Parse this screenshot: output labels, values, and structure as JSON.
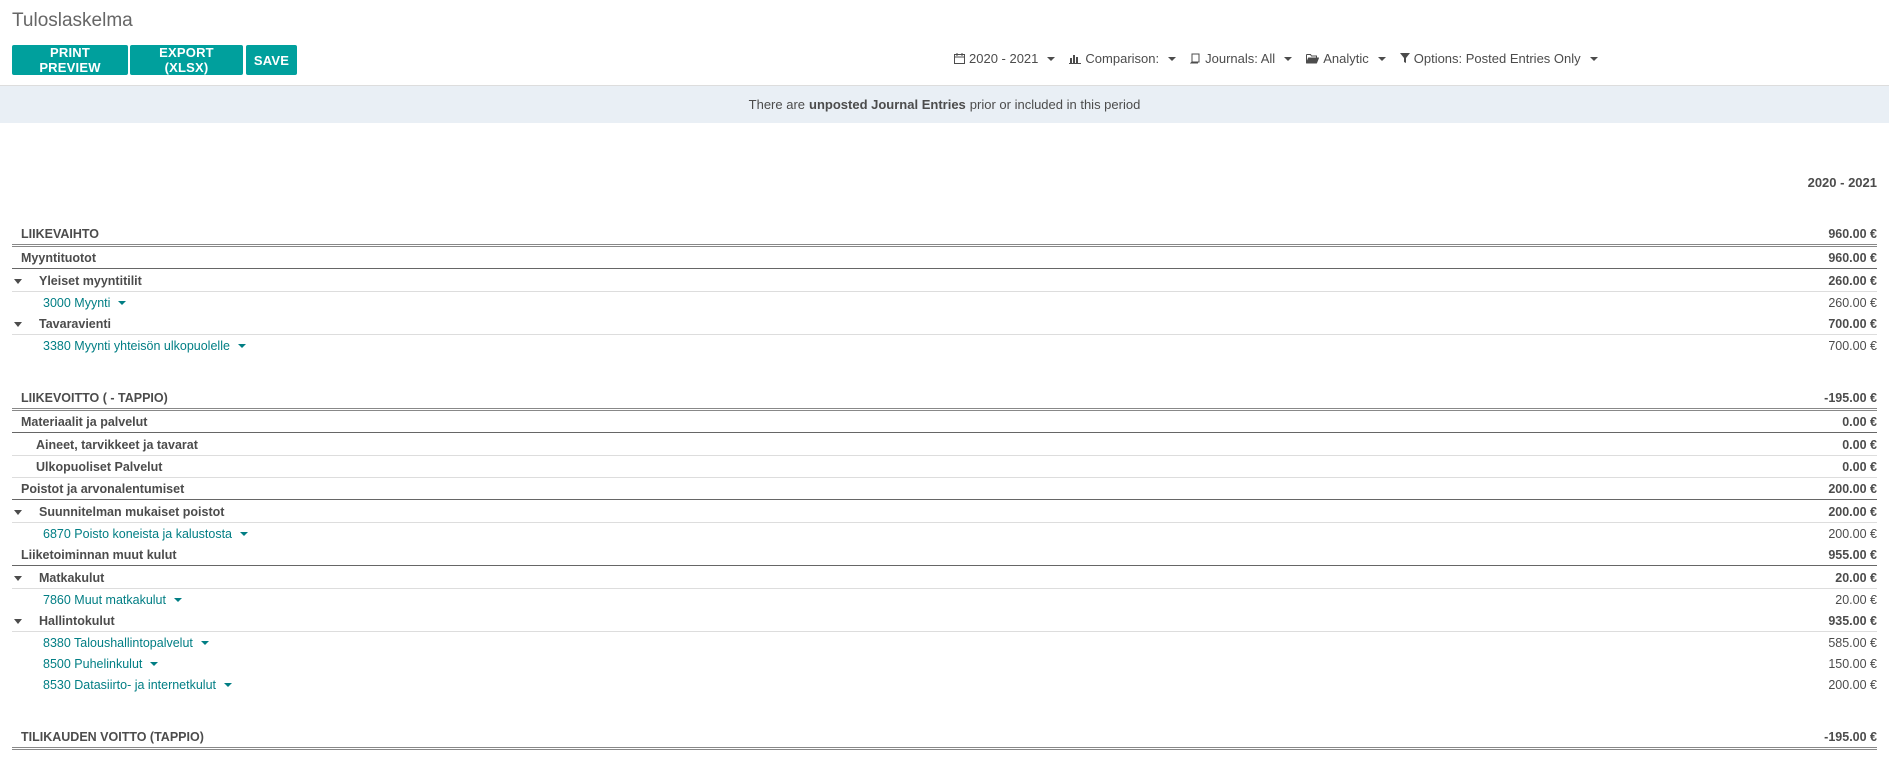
{
  "title": "Tuloslaskelma",
  "buttons": {
    "print_preview": "PRINT PREVIEW",
    "export": "EXPORT (XLSX)",
    "save": "SAVE"
  },
  "filters": {
    "period": "2020 - 2021",
    "comparison": "Comparison:",
    "journals": "Journals: All",
    "analytic": "Analytic",
    "options": "Options: Posted Entries Only"
  },
  "alert": {
    "before": "There are",
    "strong": "unposted Journal Entries",
    "after": "prior or included in this period"
  },
  "column_header": "2020 - 2021",
  "rows": [
    {
      "label": "LIIKEVAIHTO",
      "value": "960.00 €"
    },
    {
      "label": "Myyntituotot",
      "value": "960.00 €"
    },
    {
      "label": "Yleiset myyntitilit",
      "value": "260.00 €"
    },
    {
      "label": "3000 Myynti",
      "value": "260.00 €"
    },
    {
      "label": "Tavaravienti",
      "value": "700.00 €"
    },
    {
      "label": "3380 Myynti yhteisön ulkopuolelle",
      "value": "700.00 €"
    },
    {
      "label": "LIIKEVOITTO ( - TAPPIO)",
      "value": "-195.00 €"
    },
    {
      "label": "Materiaalit ja palvelut",
      "value": "0.00 €"
    },
    {
      "label": "Aineet, tarvikkeet ja tavarat",
      "value": "0.00 €"
    },
    {
      "label": "Ulkopuoliset Palvelut",
      "value": "0.00 €"
    },
    {
      "label": "Poistot ja arvonalentumiset",
      "value": "200.00 €"
    },
    {
      "label": "Suunnitelman mukaiset poistot",
      "value": "200.00 €"
    },
    {
      "label": "6870 Poisto koneista ja kalustosta",
      "value": "200.00 €"
    },
    {
      "label": "Liiketoiminnan muut kulut",
      "value": "955.00 €"
    },
    {
      "label": "Matkakulut",
      "value": "20.00 €"
    },
    {
      "label": "7860 Muut matkakulut",
      "value": "20.00 €"
    },
    {
      "label": "Hallintokulut",
      "value": "935.00 €"
    },
    {
      "label": "8380 Taloushallintopalvelut",
      "value": "585.00 €"
    },
    {
      "label": "8500 Puhelinkulut",
      "value": "150.00 €"
    },
    {
      "label": "8530 Datasiirto- ja internetkulut",
      "value": "200.00 €"
    },
    {
      "label": "TILIKAUDEN VOITTO (TAPPIO)",
      "value": "-195.00 €"
    }
  ]
}
